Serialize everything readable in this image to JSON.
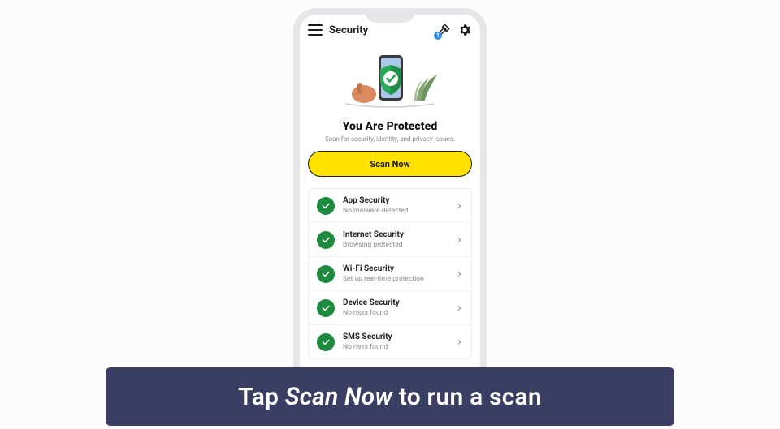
{
  "app_bar": {
    "title": "Security",
    "tools_badge": "1"
  },
  "hero": {
    "title": "You Are Protected",
    "subtitle": "Scan for security, identity, and privacy issues.",
    "scan_label": "Scan Now"
  },
  "items": [
    {
      "title": "App Security",
      "subtitle": "No malware detected"
    },
    {
      "title": "Internet Security",
      "subtitle": "Browsing protected"
    },
    {
      "title": "Wi-Fi Security",
      "subtitle": "Set up real-time protection"
    },
    {
      "title": "Device Security",
      "subtitle": "No risks found"
    },
    {
      "title": "SMS Security",
      "subtitle": "No risks found"
    }
  ],
  "caption": {
    "prefix": "Tap ",
    "emph": "Scan Now",
    "suffix": " to run a scan"
  }
}
